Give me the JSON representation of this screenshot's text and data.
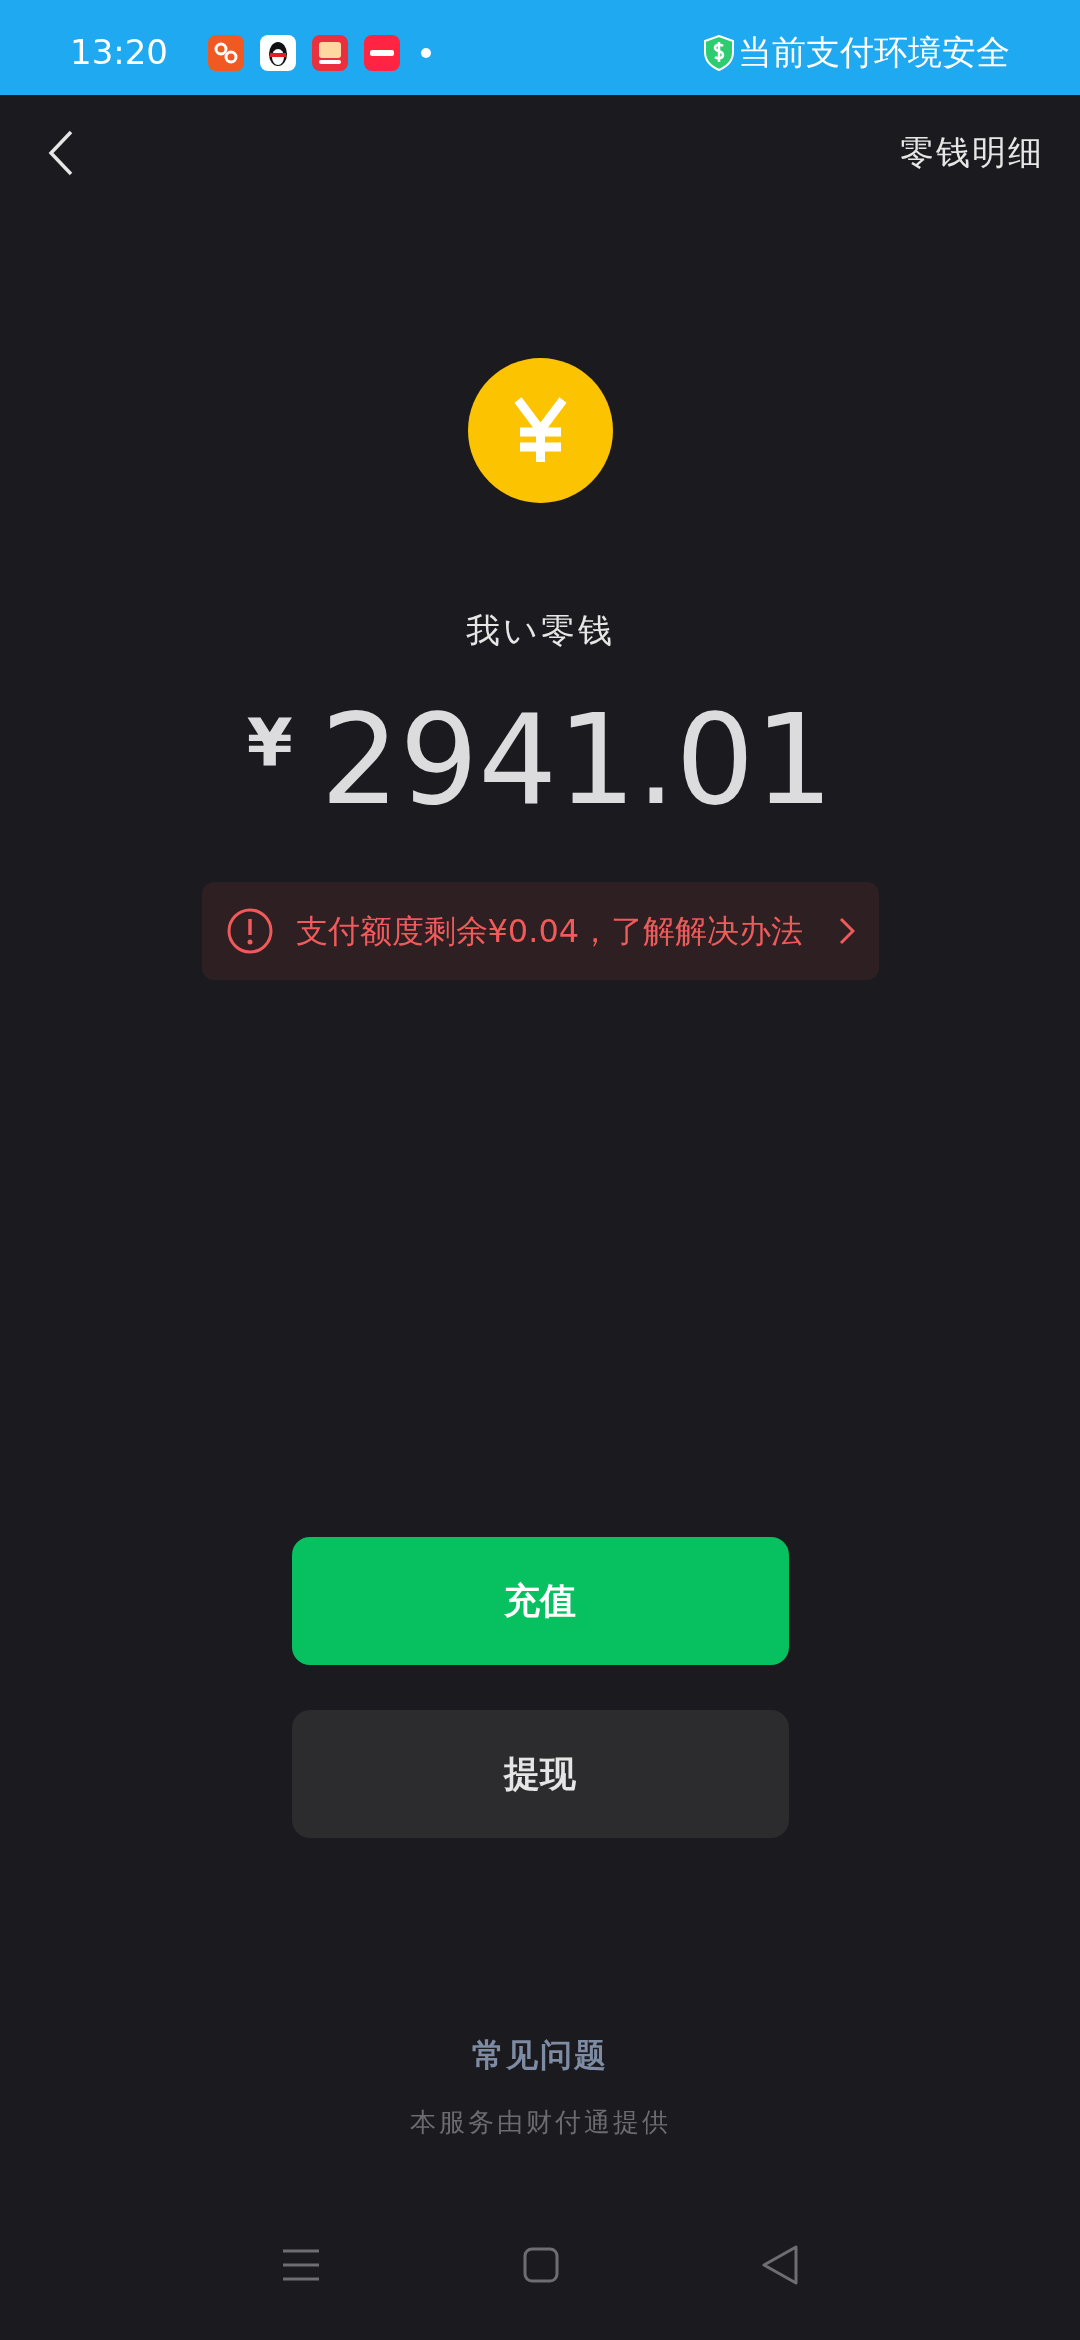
{
  "status_bar": {
    "time": "13:20",
    "security": "当前支付环境安全"
  },
  "header": {
    "title": "零钱明细"
  },
  "wallet": {
    "label": "我い零钱",
    "currency": "¥",
    "amount": "2941.01"
  },
  "alert": {
    "text": "支付额度剩余¥0.04，了解解决办法"
  },
  "buttons": [
    {
      "label": "充值",
      "kind": "primary"
    },
    {
      "label": "提现",
      "kind": "secondary"
    }
  ],
  "footer": {
    "faq": "常见问题",
    "provider": "本服务由财付通提供"
  }
}
